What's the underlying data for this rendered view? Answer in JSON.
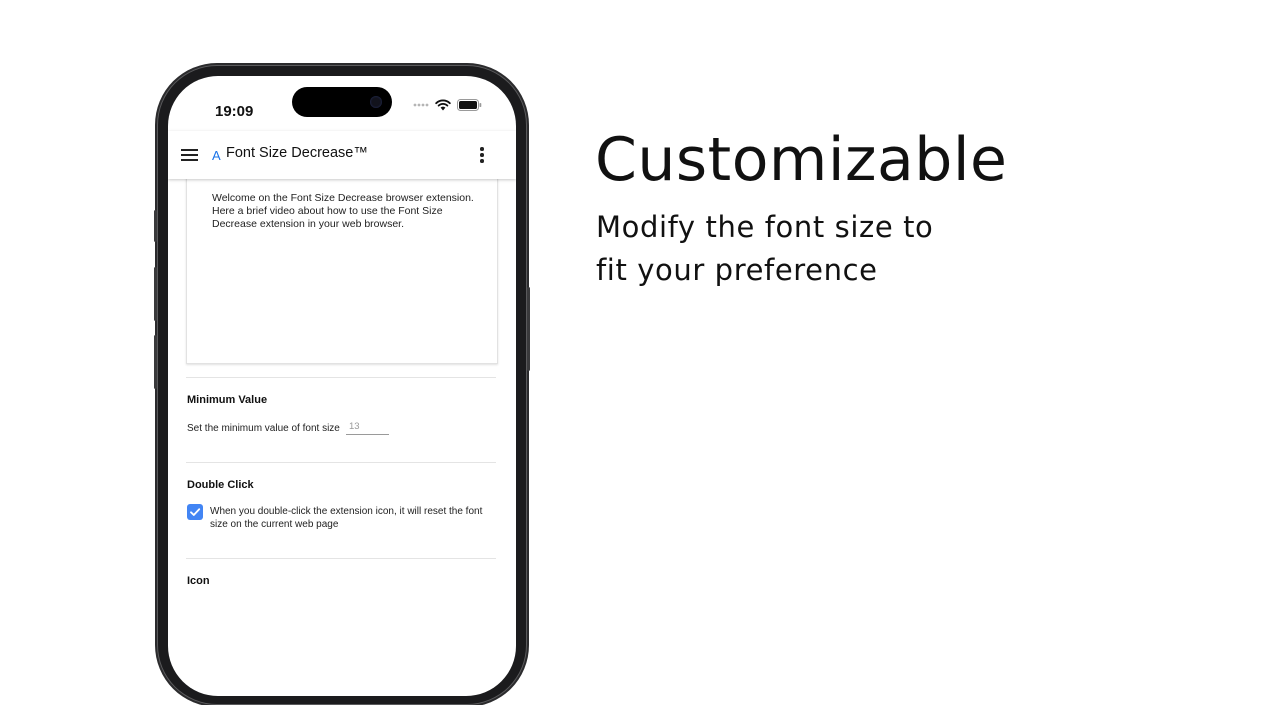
{
  "promo": {
    "headline": "Customizable",
    "subline_1": "Modify the font size to",
    "subline_2": "fit your preference"
  },
  "device": {
    "status_time": "19:09",
    "status_icons": [
      "signal-dots-icon",
      "wifi-icon",
      "battery-icon"
    ]
  },
  "app": {
    "logo_letter": "A",
    "title": "Font Size Decrease™",
    "accent_color": "#1a73e8",
    "menu_icon": "hamburger-menu-icon",
    "more_icon": "more-vertical-icon"
  },
  "content": {
    "video_intro": "Welcome on the Font Size Decrease browser extension. Here a brief video about how to use the Font Size Decrease extension in your web browser.",
    "minimum_value": {
      "title": "Minimum Value",
      "label": "Set the minimum value of font size",
      "placeholder": "13"
    },
    "double_click": {
      "title": "Double Click",
      "checked": true,
      "checkbox_color": "#4285f4",
      "description": "When you double-click the extension icon, it will reset the font size on the current web page"
    },
    "icon_section": {
      "title": "Icon"
    }
  }
}
